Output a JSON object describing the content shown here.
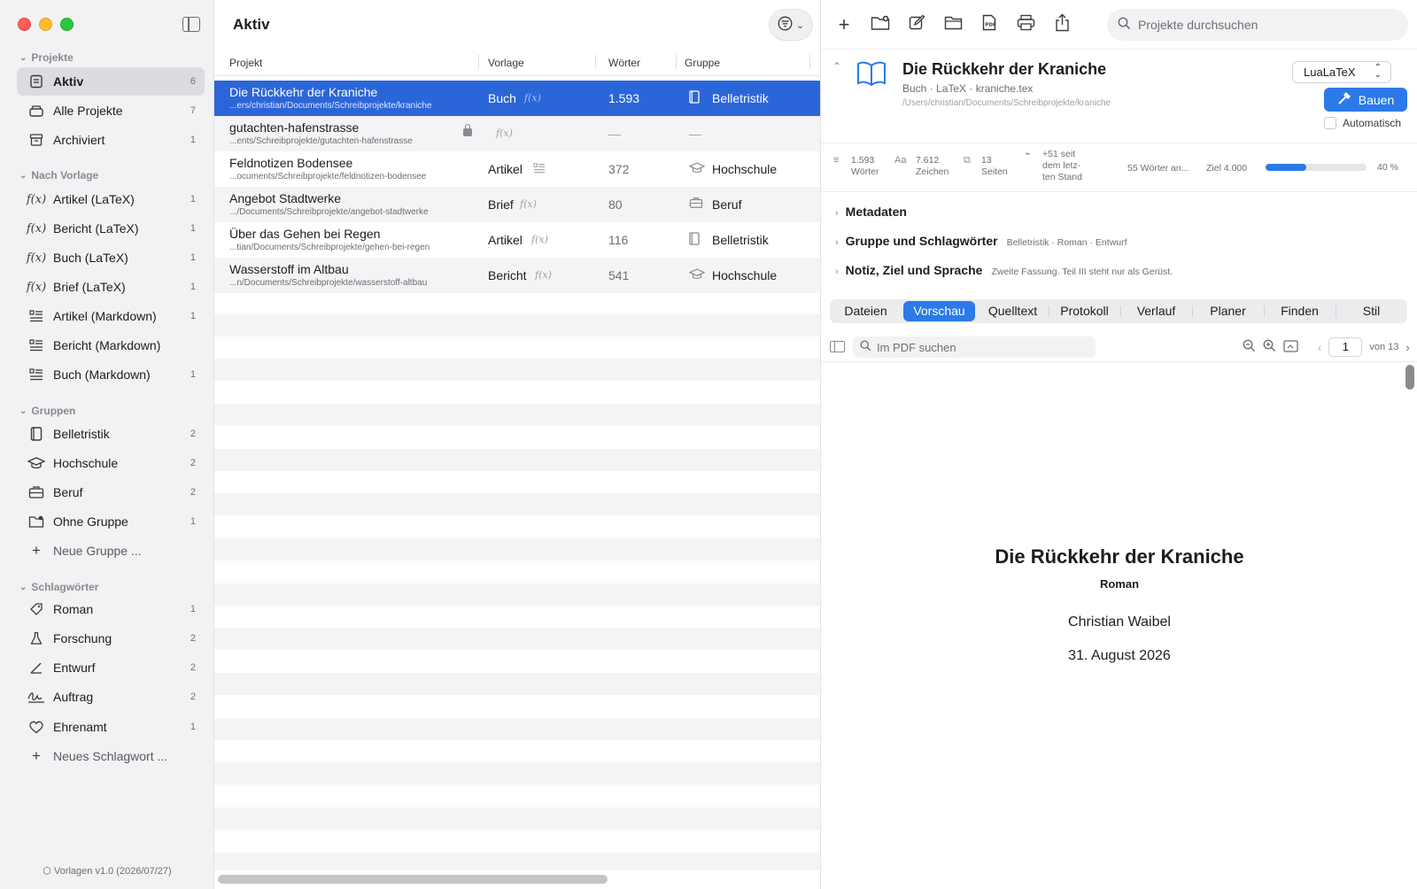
{
  "sidebar": {
    "sections": {
      "projects": "Projekte",
      "by_template": "Nach Vorlage",
      "groups": "Gruppen",
      "tags": "Schlagwörter"
    },
    "projects": [
      {
        "label": "Aktiv",
        "count": "6",
        "icon": "tray-icon"
      },
      {
        "label": "Alle Projekte",
        "count": "7",
        "icon": "stack-icon"
      },
      {
        "label": "Archiviert",
        "count": "1",
        "icon": "archive-box-icon"
      }
    ],
    "templates": [
      {
        "label": "Artikel (LaTeX)",
        "count": "1",
        "icon": "function-icon"
      },
      {
        "label": "Bericht (LaTeX)",
        "count": "1",
        "icon": "function-icon"
      },
      {
        "label": "Buch (LaTeX)",
        "count": "1",
        "icon": "function-icon"
      },
      {
        "label": "Brief (LaTeX)",
        "count": "1",
        "icon": "function-icon"
      },
      {
        "label": "Artikel (Markdown)",
        "count": "1",
        "icon": "text-list-icon"
      },
      {
        "label": "Bericht (Markdown)",
        "count": "",
        "icon": "text-list-icon"
      },
      {
        "label": "Buch (Markdown)",
        "count": "1",
        "icon": "text-list-icon"
      }
    ],
    "groups": [
      {
        "label": "Belletristik",
        "count": "2",
        "icon": "book-icon"
      },
      {
        "label": "Hochschule",
        "count": "2",
        "icon": "graduation-cap-icon"
      },
      {
        "label": "Beruf",
        "count": "2",
        "icon": "briefcase-icon"
      },
      {
        "label": "Ohne Gruppe",
        "count": "1",
        "icon": "folder-badge-icon"
      }
    ],
    "new_group": "Neue Gruppe ...",
    "tags": [
      {
        "label": "Roman",
        "count": "1",
        "icon": "tag-icon"
      },
      {
        "label": "Forschung",
        "count": "2",
        "icon": "flask-icon"
      },
      {
        "label": "Entwurf",
        "count": "2",
        "icon": "pencil-angle-icon"
      },
      {
        "label": "Auftrag",
        "count": "2",
        "icon": "signature-icon"
      },
      {
        "label": "Ehrenamt",
        "count": "1",
        "icon": "heart-icon"
      }
    ],
    "new_tag": "Neues Schlagwort ...",
    "footer": "Vorlagen v1.0 (2026/07/27)"
  },
  "list": {
    "title": "Aktiv",
    "columns": [
      "Projekt",
      "Vorlage",
      "Wörter",
      "Gruppe"
    ],
    "rows": [
      {
        "name": "Die Rückkehr der Kraniche",
        "path": "...ers/christian/Documents/Schreibprojekte/kraniche",
        "vorlage": "Buch",
        "words": "1.593",
        "group": "Belletristik",
        "group_icon": "book-icon",
        "selected": true
      },
      {
        "name": "gutachten-hafenstrasse",
        "path": "...ents/Schreibprojekte/gutachten-hafenstrasse",
        "vorlage": "",
        "words": "—",
        "group": "—",
        "group_icon": "",
        "locked": true
      },
      {
        "name": "Feldnotizen Bodensee",
        "path": "...ocuments/Schreibprojekte/feldnotizen-bodensee",
        "vorlage": "Artikel",
        "words": "372",
        "group": "Hochschule",
        "group_icon": "graduation-cap-icon"
      },
      {
        "name": "Angebot Stadtwerke",
        "path": ".../Documents/Schreibprojekte/angebot-stadtwerke",
        "vorlage": "Brief",
        "words": "80",
        "group": "Beruf",
        "group_icon": "briefcase-icon"
      },
      {
        "name": "Über das Gehen bei Regen",
        "path": "...tian/Documents/Schreibprojekte/gehen-bei-regen",
        "vorlage": "Artikel",
        "words": "116",
        "group": "Belletristik",
        "group_icon": "book-icon"
      },
      {
        "name": "Wasserstoff im Altbau",
        "path": "...n/Documents/Schreibprojekte/wasserstoff-altbau",
        "vorlage": "Bericht",
        "words": "541",
        "group": "Hochschule",
        "group_icon": "graduation-cap-icon"
      }
    ]
  },
  "detail": {
    "search_placeholder": "Projekte durchsuchen",
    "title": "Die Rückkehr der Kraniche",
    "subtitle": "Buch · LaTeX · kraniche.tex",
    "path": "/Users/christian/Documents/Schreibprojekte/kraniche",
    "engine": "LuaLaTeX",
    "build_label": "Bauen",
    "auto_label": "Automatisch",
    "stats": {
      "words_value": "1.593",
      "words_label": "Wörter",
      "chars_value": "7.612",
      "chars_label": "Zeichen",
      "pages_value": "13",
      "pages_label": "Seiten",
      "delta_line1": "+51 seit",
      "delta_line2": "dem letz-",
      "delta_line3": "ten Stand",
      "goal_note": "55 Wörter an...",
      "goal_label": "Ziel 4.000",
      "progress_fraction": 0.4,
      "progress_label": "40 %"
    },
    "sections": [
      {
        "title": "Metadaten",
        "summary": ""
      },
      {
        "title": "Gruppe und Schlagwörter",
        "summary": "Belletristik · Roman · Entwurf"
      },
      {
        "title": "Notiz, Ziel und Sprache",
        "summary": "Zweite Fassung. Teil III steht nur als Gerüst."
      }
    ],
    "tabs": [
      "Dateien",
      "Vorschau",
      "Quelltext",
      "Protokoll",
      "Verlauf",
      "Planer",
      "Finden",
      "Stil"
    ],
    "active_tab": "Vorschau",
    "pdf": {
      "search_placeholder": "Im PDF suchen",
      "page": "1",
      "of_pages": "von 13",
      "doc_title": "Die Rückkehr der Kraniche",
      "doc_subtitle": "Roman",
      "author": "Christian Waibel",
      "date": "31. August 2026"
    }
  },
  "colors": {
    "accent": "#2b7ae8",
    "selection": "#2b66d9"
  }
}
